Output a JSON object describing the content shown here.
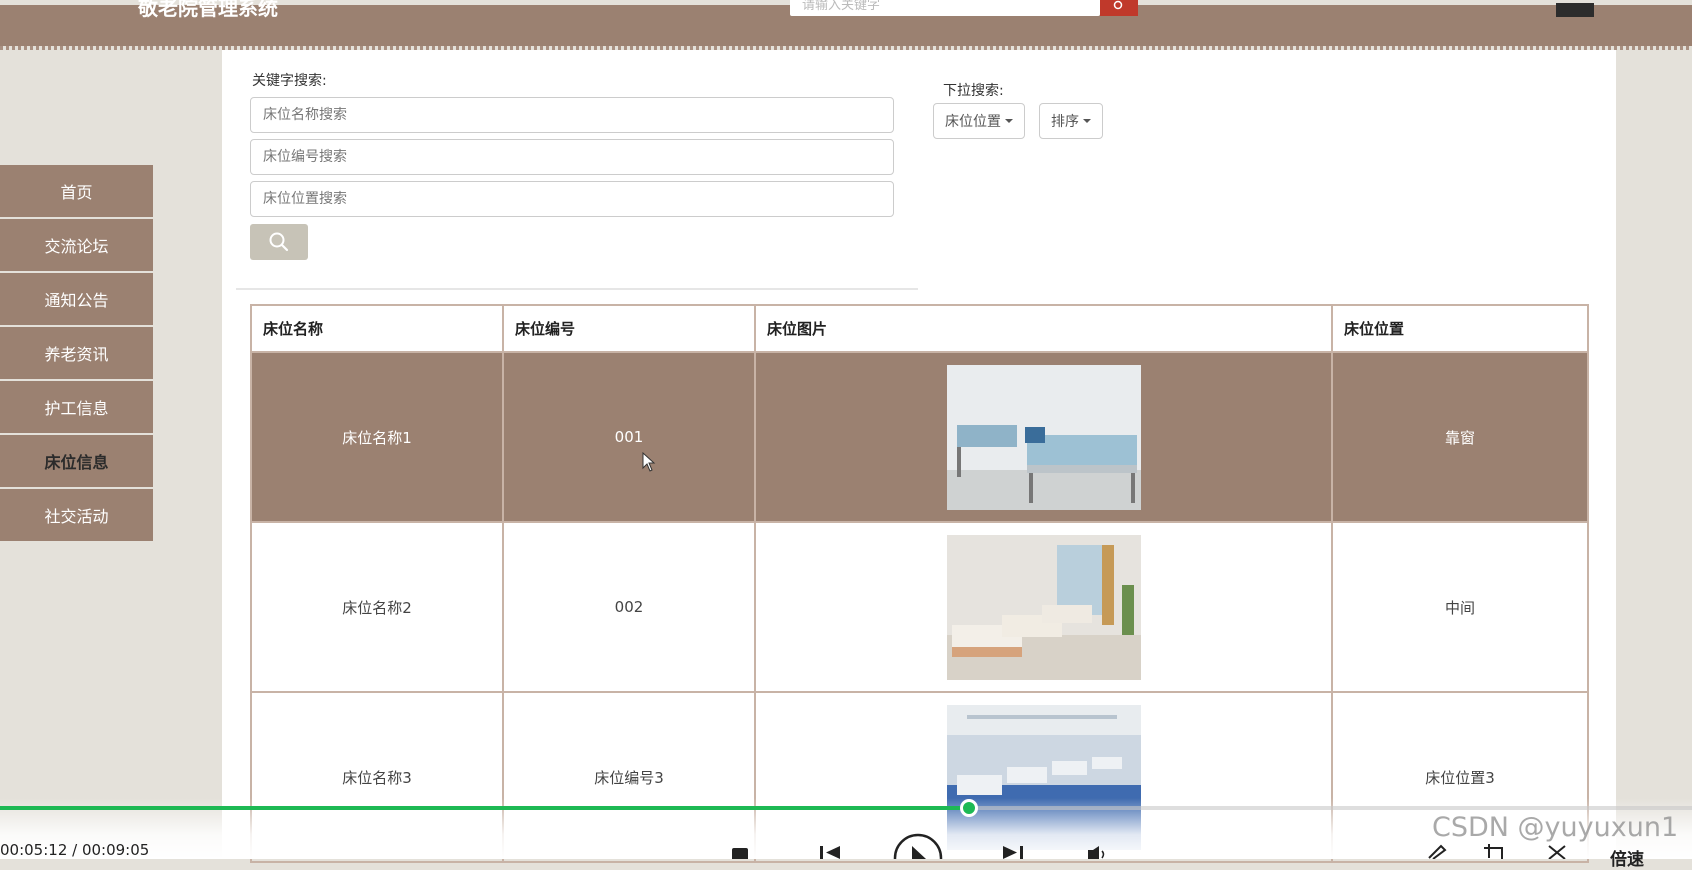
{
  "header": {
    "site_title": "敬老院管理系统",
    "search_placeholder": "请输入关键字"
  },
  "sidebar": {
    "items": [
      {
        "label": "首页",
        "active": false
      },
      {
        "label": "交流论坛",
        "active": false
      },
      {
        "label": "通知公告",
        "active": false
      },
      {
        "label": "养老资讯",
        "active": false
      },
      {
        "label": "护工信息",
        "active": false
      },
      {
        "label": "床位信息",
        "active": true
      },
      {
        "label": "社交活动",
        "active": false
      }
    ]
  },
  "search": {
    "keyword_label": "关键字搜索:",
    "name_placeholder": "床位名称搜索",
    "number_placeholder": "床位编号搜索",
    "location_placeholder": "床位位置搜索",
    "dropdown_label": "下拉搜索:",
    "dropdown_location": "床位位置",
    "dropdown_sort": "排序"
  },
  "table": {
    "headers": [
      "床位名称",
      "床位编号",
      "床位图片",
      "床位位置"
    ],
    "rows": [
      {
        "name": "床位名称1",
        "number": "001",
        "location": "靠窗"
      },
      {
        "name": "床位名称2",
        "number": "002",
        "location": "中间"
      },
      {
        "name": "床位名称3",
        "number": "床位编号3",
        "location": "床位位置3"
      }
    ]
  },
  "player": {
    "time": "00:05:12 / 00:09:05",
    "progress": 0.5726,
    "speed_label": "倍速",
    "watermark": "CSDN @yuyuxun1"
  },
  "colors": {
    "brand": "#9b8171",
    "progress": "#1db954"
  }
}
